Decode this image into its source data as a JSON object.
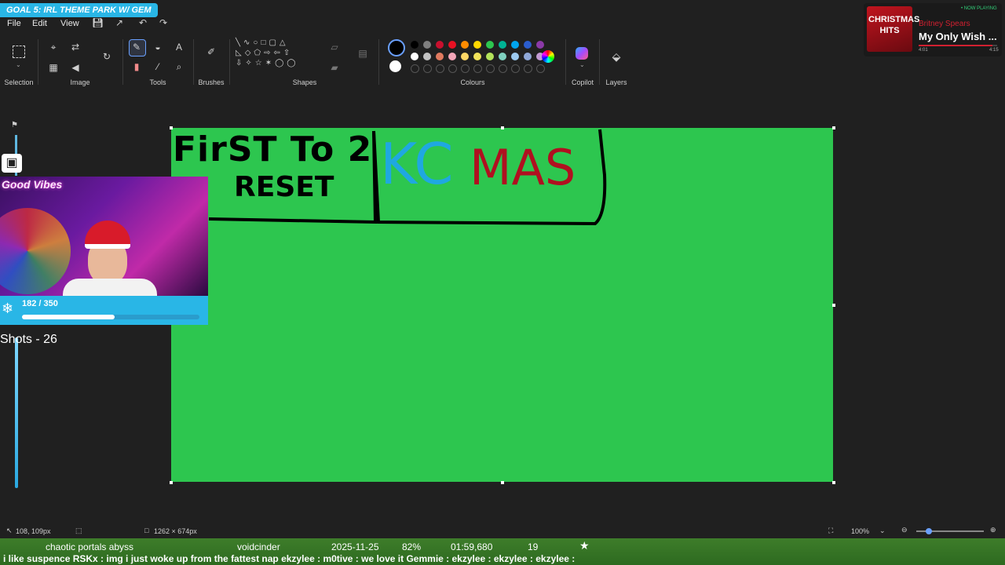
{
  "overlay": {
    "goal_banner": "GOAL 5: IRL THEME PARK W/ GEM",
    "goal_progress_text": "182 / 350",
    "goal_progress_fraction": 0.52,
    "shots_label": "Shots - 26",
    "webcam_sign": "Good Vibes"
  },
  "menu": {
    "file": "File",
    "edit": "Edit",
    "view": "View"
  },
  "ribbon": {
    "groups": {
      "selection": "Selection",
      "image": "Image",
      "tools": "Tools",
      "brushes": "Brushes",
      "shapes": "Shapes",
      "colours": "Colours",
      "copilot": "Copilot",
      "layers": "Layers"
    },
    "palette_row1": [
      "#000000",
      "#7f7f7f",
      "#c8102e",
      "#e81123",
      "#ff8c00",
      "#ffd800",
      "#2dc64f",
      "#00b294",
      "#00a4ef",
      "#2b5dcd",
      "#8b3aa8"
    ],
    "palette_row2": [
      "#ffffff",
      "#c3c3c3",
      "#e07a5f",
      "#f4a6b8",
      "#ffd866",
      "#f2e35a",
      "#b3e35a",
      "#7fd1c0",
      "#9ccaf0",
      "#8fa8d8",
      "#c39bd3"
    ]
  },
  "canvas": {
    "background": "#2dc64f",
    "drawn_text_1": "FirST To 2",
    "drawn_text_2": "RESET",
    "drawn_kc": "KC",
    "drawn_mas": "MAS"
  },
  "now_playing": {
    "badge": "• NOW PLAYING",
    "album": "CHRISTMAS HITS",
    "artist": "Britney Spears",
    "title": "My Only Wish ...",
    "elapsed": "4:01",
    "total": "4:15"
  },
  "statusbar": {
    "cursor_position": "108, 109px",
    "canvas_size": "1262 × 674px",
    "zoom": "100%"
  },
  "ticker": {
    "items": [
      "chaotic portals abyss",
      "voidcinder",
      "2025-11-25",
      "82%",
      "01:59,680",
      "19"
    ],
    "chat": "i like suspence   RSKx : img i just woke up from the fattest nap   ekzylee :   m0tive : we love it   Gemmie :   ekzylee :   ekzylee :   ekzylee :"
  }
}
